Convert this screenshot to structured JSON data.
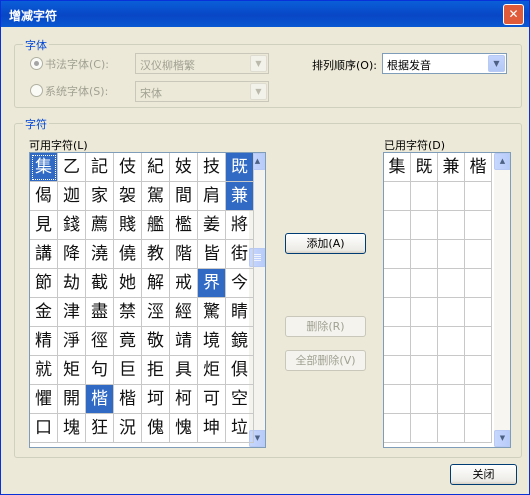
{
  "window": {
    "title": "增减字符",
    "close_glyph": "✕"
  },
  "font_group": {
    "label": "字体",
    "calligraphy_radio_label": "书法字体(C):",
    "calligraphy_font_value": "汉仪柳楷繁",
    "system_radio_label": "系统字体(S):",
    "system_font_value": "宋体",
    "sort_label": "排列顺序(O):",
    "sort_value": "根据发音"
  },
  "chars_group": {
    "label": "字符",
    "available_label": "可用字符(L)",
    "used_label": "已用字符(D)",
    "available_chars": [
      [
        "集",
        "乙",
        "記",
        "伎",
        "紀",
        "妓",
        "技",
        "既"
      ],
      [
        "偈",
        "迦",
        "家",
        "袈",
        "駕",
        "間",
        "肩",
        "兼"
      ],
      [
        "見",
        "錢",
        "薦",
        "賤",
        "艦",
        "檻",
        "姜",
        "將"
      ],
      [
        "講",
        "降",
        "澆",
        "僥",
        "教",
        "階",
        "皆",
        "街"
      ],
      [
        "節",
        "劫",
        "截",
        "她",
        "解",
        "戒",
        "界",
        "今"
      ],
      [
        "金",
        "津",
        "盡",
        "禁",
        "涇",
        "經",
        "驚",
        "睛"
      ],
      [
        "精",
        "淨",
        "徑",
        "竟",
        "敬",
        "靖",
        "境",
        "鏡"
      ],
      [
        "就",
        "矩",
        "句",
        "巨",
        "拒",
        "具",
        "炬",
        "俱"
      ],
      [
        "懼",
        "開",
        "楷",
        "楷",
        "坷",
        "柯",
        "可",
        "空"
      ],
      [
        "口",
        "塊",
        "狂",
        "況",
        "傀",
        "愧",
        "坤",
        "垃"
      ]
    ],
    "used_chars": [
      [
        "集",
        "既",
        "兼",
        "楷"
      ]
    ],
    "used_grid_rows": 10
  },
  "buttons": {
    "add": "添加(A)",
    "remove": "删除(R)",
    "remove_all": "全部删除(V)",
    "close": "关闭"
  },
  "scroll_arrows": {
    "up": "▲",
    "down": "▼",
    "combo": "▼"
  }
}
